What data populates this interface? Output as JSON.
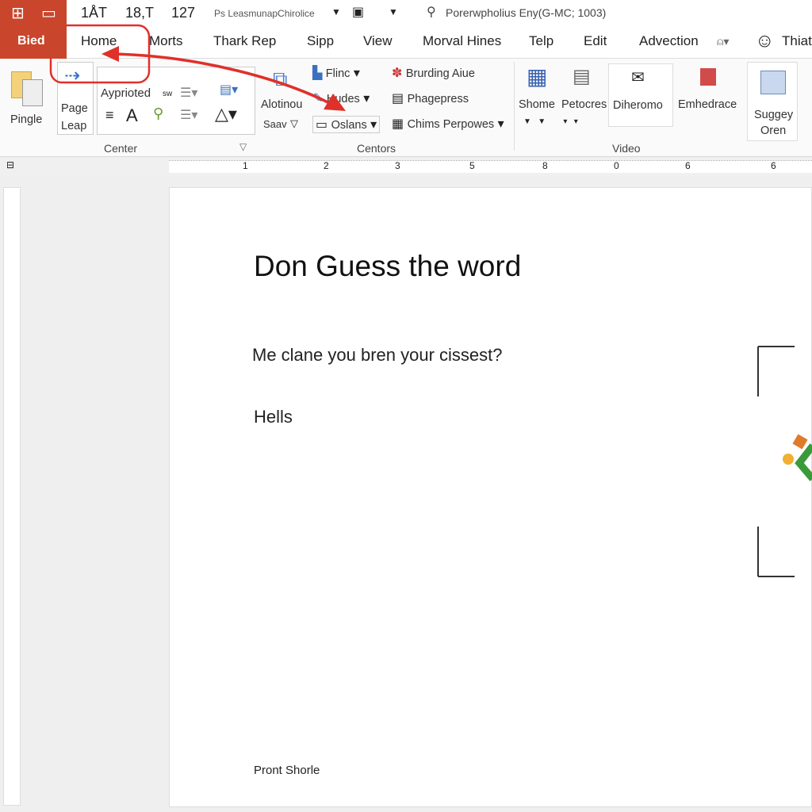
{
  "quick_access": {
    "app_button": "Bied",
    "items": [
      "1ÅT",
      "18,T",
      "127"
    ],
    "font_name": "Ps LeasmunapChirolice",
    "search_text": "Porerwpholius Eny(G-MC; 1003)"
  },
  "tabs": [
    "Home",
    "Morts",
    "Thark Rep",
    "Sipp",
    "View",
    "Morval Hines",
    "Telp",
    "Edit",
    "Advection"
  ],
  "user_label": "Thiat",
  "ribbon": {
    "pingle": "Pingle",
    "page": "Page",
    "leap": "Leap",
    "font_box": "Ayprioted",
    "font_size": "sw",
    "alotinou": "Alotinou",
    "saav": "Saav",
    "flinc": "Flinc",
    "hudes": "Hudes",
    "oslans": "Oslans",
    "brurding": "Brurding Aiue",
    "phagepress": "Phagepress",
    "chims": "Chims Perpowes",
    "shome": "Shome",
    "petocres": "Petocres",
    "diheromo": "Diheromo",
    "emhedrace": "Emhedrace",
    "suggey": "Suggey",
    "oren": "Oren",
    "groups": [
      "Center",
      "Centors",
      "Video"
    ]
  },
  "ruler_numbers": [
    "1",
    "2",
    "3",
    "5",
    "8",
    "0",
    "6",
    "6"
  ],
  "document": {
    "title": "Don Guess the word",
    "question": "Me clane you bren your cissest?",
    "answer": "Hells",
    "footer": "Pront Shorle"
  },
  "colors": {
    "accent": "#c9452b",
    "annotation": "#e0302a"
  }
}
